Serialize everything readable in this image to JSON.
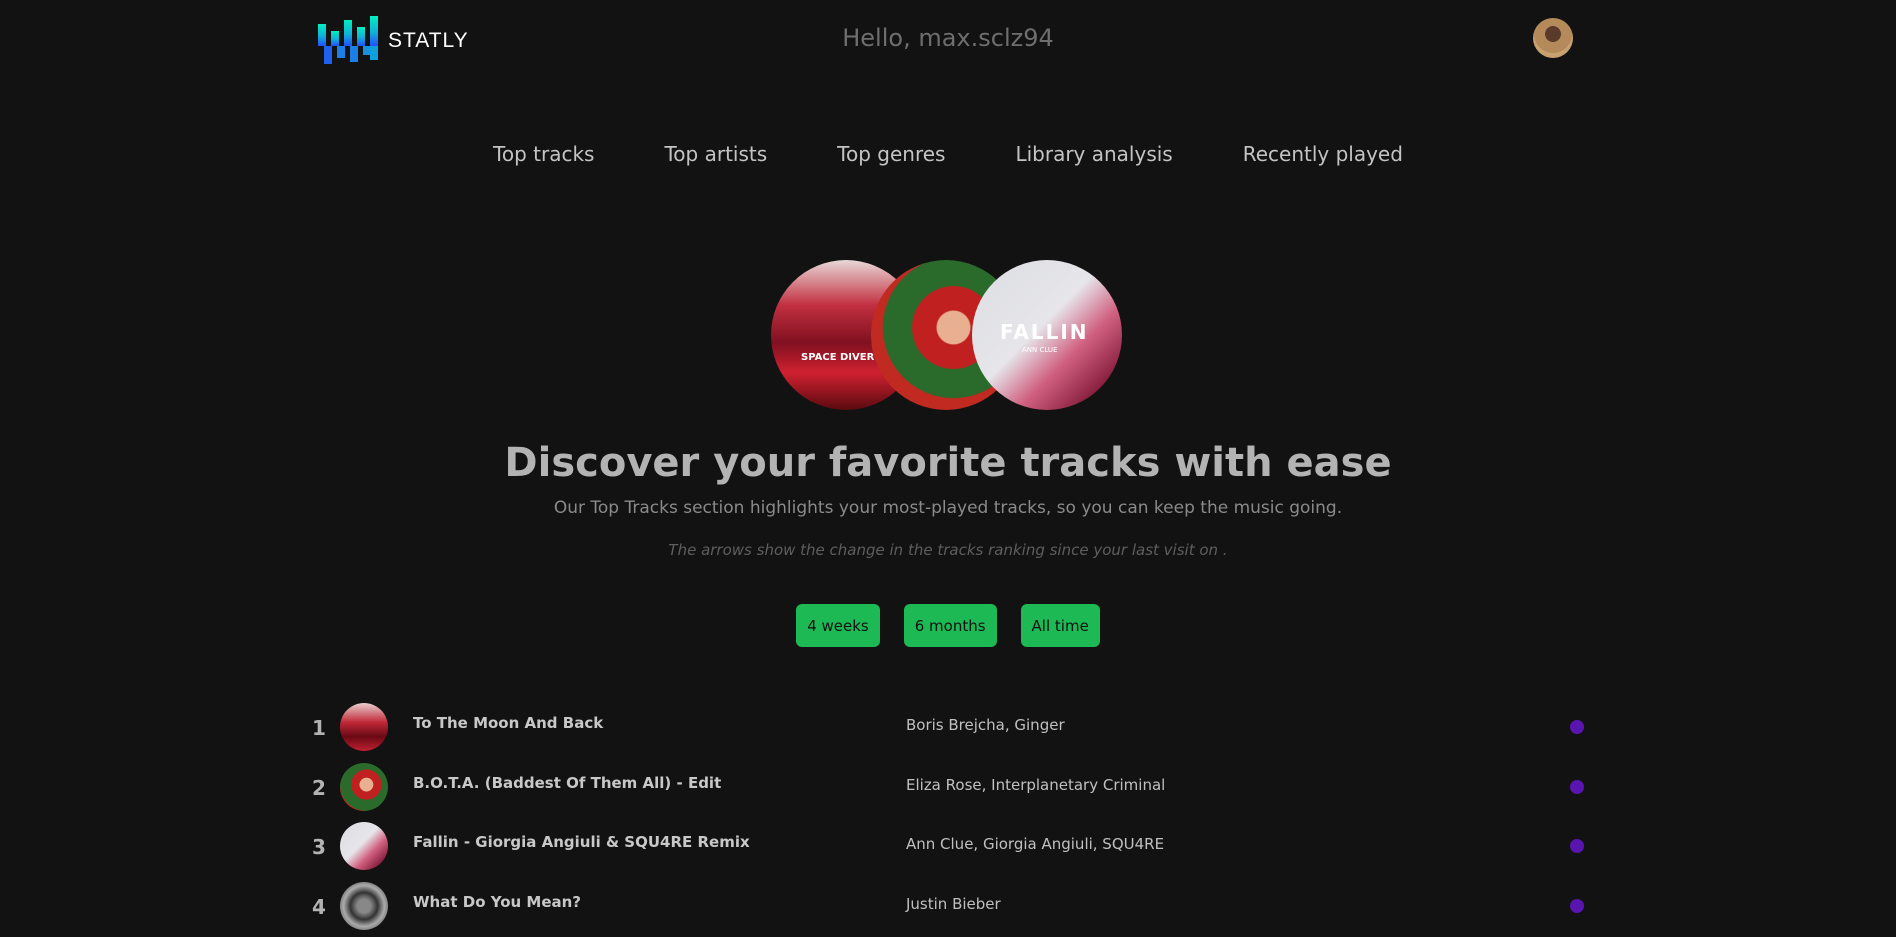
{
  "app": {
    "name": "STATLY",
    "greeting": "Hello, max.sclz94"
  },
  "nav": [
    "Top tracks",
    "Top artists",
    "Top genres",
    "Library analysis",
    "Recently played"
  ],
  "hero": {
    "covers": [
      {
        "text": "SPACE DIVER."
      },
      {
        "text": ""
      },
      {
        "text": "FALLIN",
        "subtext": "ANN CLUE"
      }
    ],
    "title": "Discover your favorite tracks with ease",
    "subtitle": "Our Top Tracks section highlights your most-played tracks, so you can keep the music going.",
    "note": "The arrows show the change in the tracks ranking since your last visit on ."
  },
  "ranges": [
    "4 weeks",
    "6 months",
    "All time"
  ],
  "tracks": [
    {
      "rank": "1",
      "title": "To The Moon And Back",
      "artists": "Boris Brejcha, Ginger"
    },
    {
      "rank": "2",
      "title": "B.O.T.A. (Baddest Of Them All) - Edit",
      "artists": "Eliza Rose, Interplanetary Criminal"
    },
    {
      "rank": "3",
      "title": "Fallin - Giorgia Angiuli & SQU4RE Remix",
      "artists": "Ann Clue, Giorgia Angiuli, SQU4RE"
    },
    {
      "rank": "4",
      "title": "What Do You Mean?",
      "artists": "Justin Bieber"
    }
  ],
  "colors": {
    "accent": "#1db954",
    "status_dot": "#5a14b0",
    "background": "#121212"
  }
}
